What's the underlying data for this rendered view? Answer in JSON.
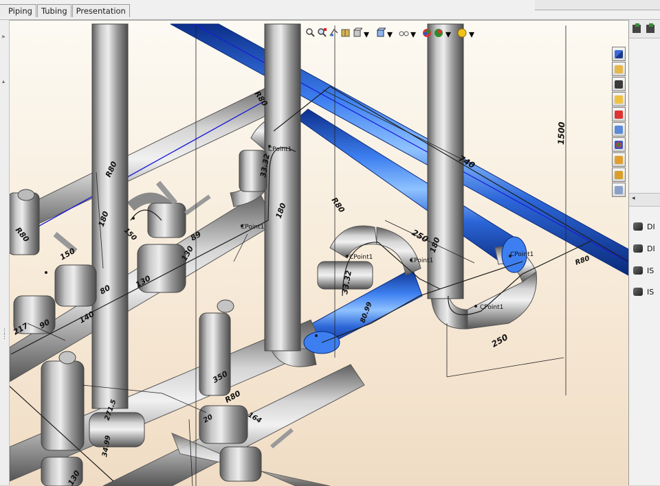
{
  "tabs": {
    "piping": "Piping",
    "tubing": "Tubing",
    "presentation": "Presentation"
  },
  "left_panel": {
    "collapse_label": "»"
  },
  "right_panel": {
    "items": [
      {
        "label": "DI",
        "icon": "part-icon"
      },
      {
        "label": "DI",
        "icon": "part-icon"
      },
      {
        "label": "IS",
        "icon": "assembly-icon"
      },
      {
        "label": "IS",
        "icon": "assembly-icon"
      }
    ]
  },
  "view_toolbar": [
    "zoom-to-fit-icon",
    "zoom-area-icon",
    "previous-view-icon",
    "section-view-icon",
    "view-orientation-icon",
    "display-style-icon",
    "hide-show-icon",
    "edit-appearance-icon",
    "apply-scene-icon",
    "view-settings-icon"
  ],
  "task_pane": [
    "solidworks-resources-icon",
    "home-icon",
    "design-library-icon",
    "file-explorer-icon",
    "search-icon",
    "view-palette-icon",
    "appearances-icon",
    "custom-properties-icon",
    "routing-library-icon",
    "toolbox-icon"
  ],
  "dimensions": {
    "d1500": "1500",
    "d740": "740",
    "d250a": "250",
    "d250b": "250",
    "d180a": "180",
    "d180b": "180",
    "d130a": "130",
    "d130b": "130",
    "d140": "140",
    "d150": "150",
    "d90": "90",
    "d80": "80",
    "d89": "89",
    "d217": "217",
    "d3332a": "33.32",
    "d3332b": "33.32",
    "d350": "350",
    "d164": "164",
    "d20": "20",
    "d8099": "80.99",
    "d2715": "271.5",
    "d3499": "34.99",
    "d130c": "130",
    "d180c": "180",
    "d150b": "150"
  },
  "radius_labels": {
    "r1": "R80",
    "r2": "R80",
    "r3": "R80",
    "r4": "R80",
    "r5": "R80",
    "r6": "R80"
  },
  "point_labels": {
    "p1": "CPoint1",
    "p2": "CPoint1",
    "p3": "CPoint1",
    "p4": "CPoint1",
    "p5": "CPoint1",
    "p6": "CPoint1"
  },
  "colors": {
    "pipe_grey": "#a9a9a9",
    "pipe_blue": "#2f6fe0",
    "sketch_line": "#1c1c1c",
    "route_blue": "#1a1ad6"
  }
}
